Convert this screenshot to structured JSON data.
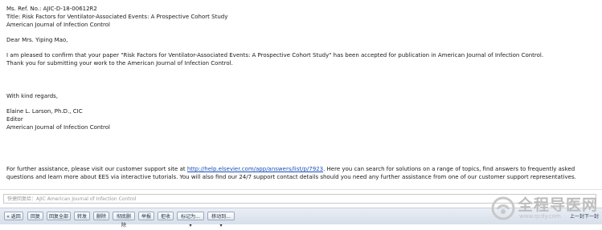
{
  "email": {
    "ref": "Ms. Ref. No.:  AJIC-D-18-00612R2",
    "title": "Title: Risk Factors for Ventilator-Associated Events: A Prospective Cohort Study",
    "journal": "American Journal of Infection Control",
    "greeting": "Dear Mrs. Yiping Mao,",
    "para1": "I am pleased to confirm that your paper \"Risk Factors for Ventilator-Associated Events: A Prospective Cohort Study\" has been accepted for publication in American Journal of Infection Control.",
    "para2": "Thank you for submitting your work to the American Journal of Infection Control.",
    "closing": "With kind regards,",
    "sig_name": "Elaine L. Larson, Ph.D., CIC",
    "sig_role": "Editor",
    "sig_journal": "American Journal of Infection Control",
    "support_pre": "For further assistance, please visit our customer support site at ",
    "support_link": "http://help.elsevier.com/app/answers/list/p/7923",
    "support_post": ". Here you can search for solutions on a range of topics, find answers to frequently asked questions and learn more about EES via interactive tutorials. You will also find our 24/7 support contact details should you need any further assistance from one of our customer support representatives."
  },
  "quick_reply": {
    "placeholder": "快捷回复给：AJIC American Journal of Infection Control"
  },
  "toolbar": {
    "back": "« 返回",
    "reply": "回复",
    "reply_all": "回复全部",
    "forward": "转发",
    "delete": "删除",
    "delete_permanent": "彻底删除",
    "report": "举报",
    "reject": "拒收",
    "mark_as": "标记为... ▾",
    "move_to": "移动到... ▾"
  },
  "pager": {
    "prev": "上一封",
    "next": "下一封"
  },
  "watermark": {
    "text": "全程导医网",
    "url": "www.qcdy.com"
  }
}
